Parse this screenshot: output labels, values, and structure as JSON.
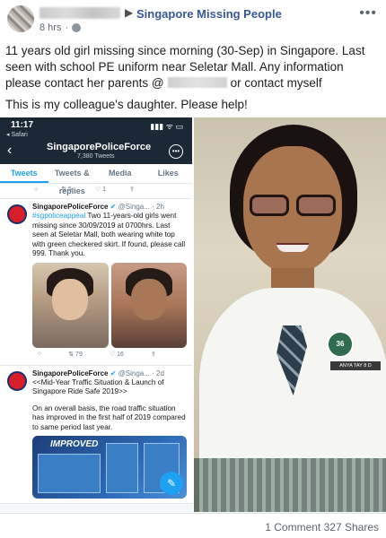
{
  "post": {
    "group_arrow": "▶",
    "group_name": "Singapore Missing People",
    "timestamp": "8 hrs",
    "more": "•••",
    "paragraph1_part1": "11 years old girl missing since morning (30-Sep) in Singapore. Last seen with school PE uniform near Seletar Mall. Any information please contact her parents @",
    "paragraph1_part2": "or contact myself",
    "paragraph2": "This is my colleague's daughter. Please help!"
  },
  "phone": {
    "status_time": "11:17",
    "status_back_app": "◂ Safari",
    "status_icons": "▮▮▮ ᯤ ▭",
    "back_glyph": "‹",
    "profile_name": "SingaporePoliceForce",
    "profile_count": "7,380 Tweets",
    "menu_glyph": "•••",
    "tabs": [
      "Tweets",
      "Tweets & replies",
      "Media",
      "Likes"
    ],
    "top_actions": [
      "○",
      "⇅ 5",
      "♡ 1",
      "⇪"
    ],
    "tweet1": {
      "name": "SingaporePoliceForce",
      "verified": "✔",
      "handle": "@Singa... · 2h",
      "hashtag": "#sgpoliceappeal",
      "text": "Two 11-years-old girls went missing since 30/09/2019 at 0700hrs. Last seen at Seletar Mall, both wearing white top with green checkered skirt. If found, please call 999. Thank you.",
      "stats": [
        "○",
        "⇅ 79",
        "♡ 16",
        "⇪"
      ]
    },
    "tweet2": {
      "name": "SingaporePoliceForce",
      "verified": "✔",
      "handle": "@Singa... · 2d",
      "text1": "<<Mid-Year Traffic Situation & Launch of Singapore Ride Safe 2019>>",
      "text2": "On an overall basis, the road traffic situation has improved in the first half of 2019 compared to same period last year.",
      "promo_title": "IMPROVED"
    },
    "fab_glyph": "✎"
  },
  "photo": {
    "badge_text": "36",
    "nametag": "ANYA TAY 8 D"
  },
  "footer": {
    "comments": "1 Comment",
    "shares": "327 Shares"
  }
}
